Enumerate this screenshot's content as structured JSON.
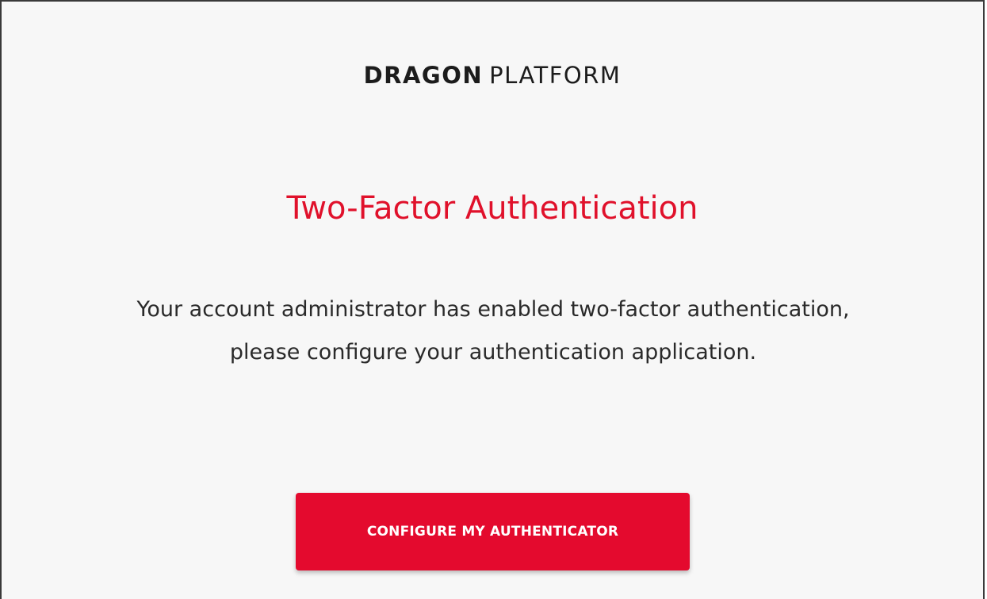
{
  "brand": {
    "strong": "DRAGON",
    "light": "PLATFORM"
  },
  "title": "Two-Factor Authentication",
  "message": "Your account administrator has enabled two-factor authentication, please configure your authentication application.",
  "cta": {
    "label": "CONFIGURE MY AUTHENTICATOR"
  },
  "colors": {
    "accent": "#e40a2e",
    "title": "#e0112b",
    "background": "#f7f7f7"
  }
}
